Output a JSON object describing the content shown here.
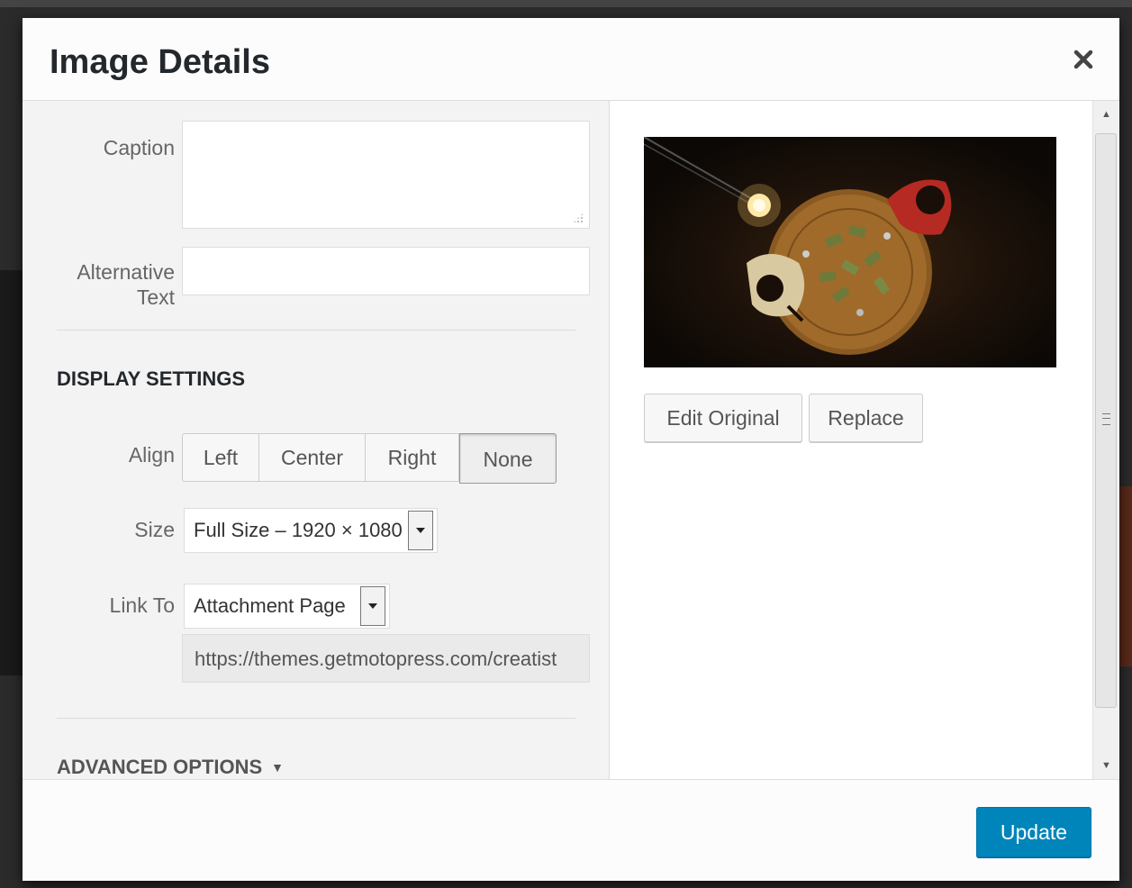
{
  "modal": {
    "title": "Image Details",
    "close_icon": "close-icon"
  },
  "attachment_details": {
    "caption_label": "Caption",
    "caption_value": "",
    "alt_label_line1": "Alternative",
    "alt_label_line2": "Text",
    "alt_value": ""
  },
  "display_settings": {
    "heading": "DISPLAY SETTINGS",
    "align_label": "Align",
    "align_options": [
      "Left",
      "Center",
      "Right",
      "None"
    ],
    "align_selected": "None",
    "size_label": "Size",
    "size_value": "Full Size – 1920 × 1080",
    "link_label": "Link To",
    "link_value": "Attachment Page",
    "link_url": "https://themes.getmotopress.com/creatist"
  },
  "advanced_options": {
    "heading": "ADVANCED OPTIONS",
    "arrow": "▼"
  },
  "image_actions": {
    "edit_label": "Edit Original",
    "replace_label": "Replace"
  },
  "footer": {
    "update_label": "Update"
  },
  "colors": {
    "primary": "#0085ba",
    "pane_bg": "#f3f3f3",
    "heading_text": "#23282d"
  }
}
